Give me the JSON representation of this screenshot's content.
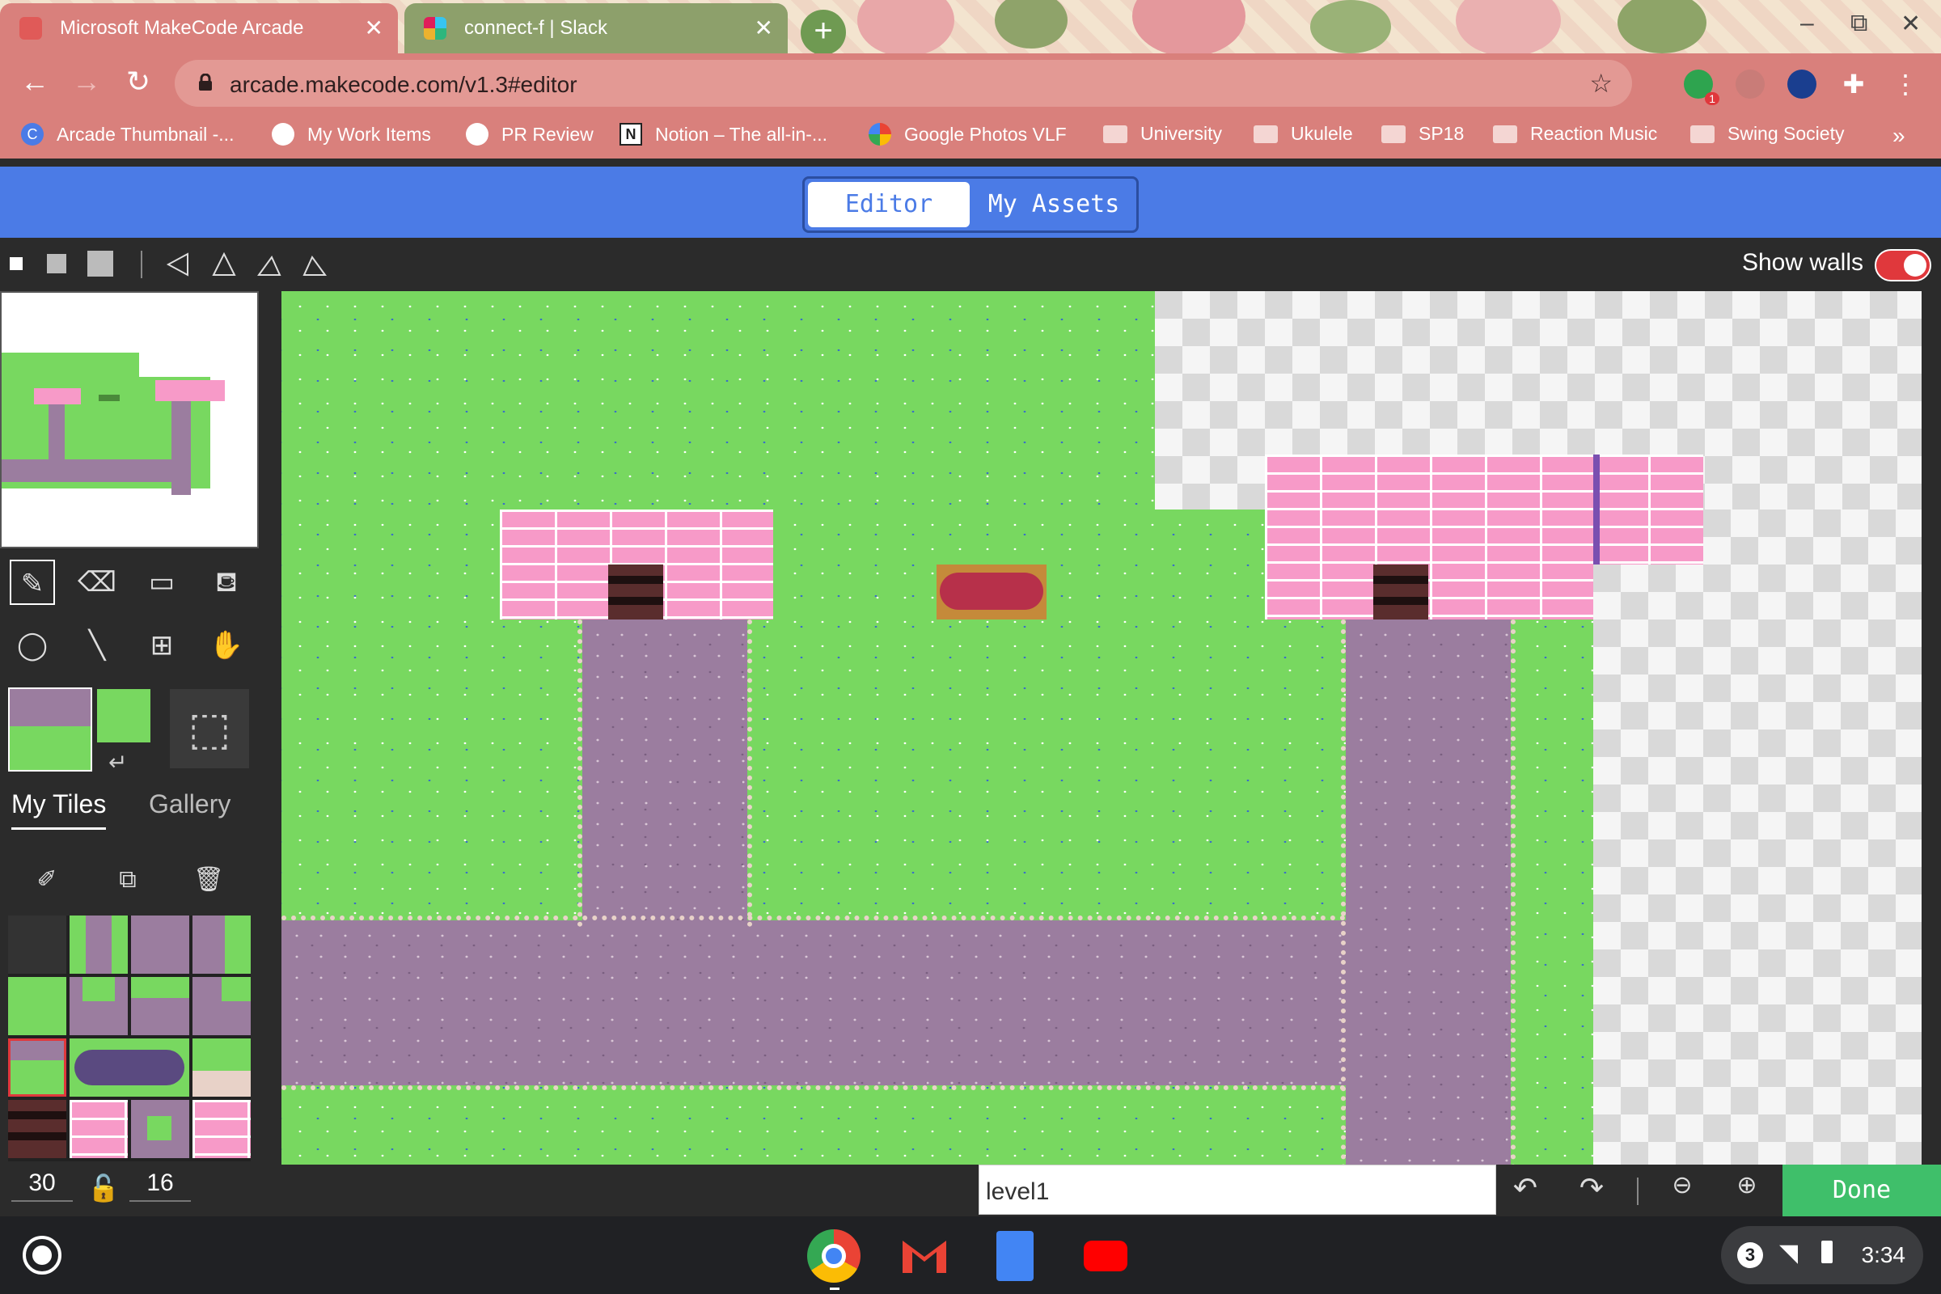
{
  "browser": {
    "tabs": [
      {
        "title": "Microsoft MakeCode Arcade",
        "active": true
      },
      {
        "title": "connect-f | Slack",
        "active": false
      }
    ],
    "url": "arcade.makecode.com/v1.3#editor",
    "bookmarks": [
      {
        "label": "Arcade Thumbnail -...",
        "icon": "arcade-c-icon"
      },
      {
        "label": "My Work Items",
        "icon": "github-icon"
      },
      {
        "label": "PR Review",
        "icon": "github-icon"
      },
      {
        "label": "Notion – The all-in-...",
        "icon": "notion-icon"
      },
      {
        "label": "Google Photos VLF",
        "icon": "google-photos-icon"
      },
      {
        "label": "University",
        "icon": "folder-icon"
      },
      {
        "label": "Ukulele",
        "icon": "folder-icon"
      },
      {
        "label": "SP18",
        "icon": "folder-icon"
      },
      {
        "label": "Reaction Music",
        "icon": "folder-icon"
      },
      {
        "label": "Swing Society",
        "icon": "folder-icon"
      }
    ],
    "more_bookmarks": "»",
    "extension_badge": "1"
  },
  "app": {
    "tabs": {
      "editor": "Editor",
      "assets": "My Assets"
    },
    "show_walls_label": "Show walls",
    "show_walls": true,
    "tile_tabs": {
      "mine": "My Tiles",
      "gallery": "Gallery"
    },
    "width": "30",
    "height": "16",
    "level_name": "level1",
    "done_label": "Done"
  },
  "system": {
    "notification_count": "3",
    "time": "3:34"
  },
  "colors": {
    "accent": "#4b7be6",
    "grass": "#78d860",
    "path": "#9b7d9f",
    "brick": "#f79ac8",
    "done": "#3fbf6a",
    "toggle_on": "#e0383c"
  }
}
